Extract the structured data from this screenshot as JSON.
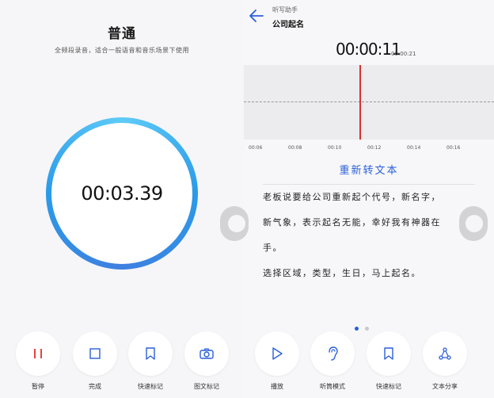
{
  "colors": {
    "accent": "#2a5fd9",
    "ring": "#2b9ae8",
    "pause": "#e5433f",
    "playhead": "#d9302f"
  },
  "left": {
    "title": "普通",
    "description": "全频段录音，适合一般语音和音乐场景下使用",
    "timer": "00:03.39",
    "controls": [
      {
        "label": "暂停",
        "icon": "pause-icon"
      },
      {
        "label": "完成",
        "icon": "stop-icon"
      },
      {
        "label": "快速标记",
        "icon": "bookmark-icon"
      },
      {
        "label": "图文标记",
        "icon": "camera-icon"
      }
    ]
  },
  "right": {
    "subtitle": "听写助手",
    "name": "公司起名",
    "current_time": "00:00:11",
    "total_time": "00:00:21",
    "ticks": [
      "00:06",
      "00:08",
      "00:10",
      "00:12",
      "00:14",
      "00:16"
    ],
    "convert_label": "重新转文本",
    "paragraphs": [
      "老板说要给公司重新起个代号，新名字，",
      "新气象，表示起名无能，幸好我有神器在",
      "手。",
      "选择区域，类型，生日，马上起名。"
    ],
    "controls": [
      {
        "label": "播放",
        "icon": "play-icon"
      },
      {
        "label": "听筒模式",
        "icon": "ear-icon"
      },
      {
        "label": "快速标记",
        "icon": "bookmark-icon"
      },
      {
        "label": "文本分享",
        "icon": "share-icon"
      }
    ]
  }
}
